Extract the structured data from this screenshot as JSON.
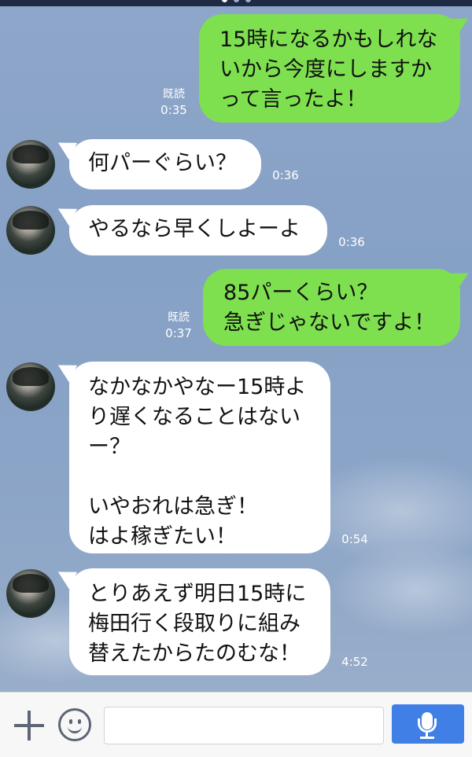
{
  "page_indicator": {
    "count": 3,
    "active_index": 0
  },
  "messages": [
    {
      "direction": "out",
      "text": "15時になるかもしれな\nいから今度にしますか\nって言ったよ！",
      "read": "既読",
      "time": "0:35"
    },
    {
      "direction": "in",
      "text": "何パーぐらい？",
      "time": "0:36"
    },
    {
      "direction": "in",
      "text": "やるなら早くしよーよ",
      "time": "0:36"
    },
    {
      "direction": "out",
      "text": "85パーくらい？\n急ぎじゃないですよ！",
      "read": "既読",
      "time": "0:37"
    },
    {
      "direction": "in",
      "text": "なかなかやなー15時よ\nり遅くなることはない\nー？\n\nいやおれは急ぎ！\nはよ稼ぎたい！",
      "time": "0:54"
    },
    {
      "direction": "in",
      "text": "とりあえず明日15時に\n梅田行く段取りに組み\n替えたからたのむな！",
      "time": "4:52"
    }
  ],
  "input_bar": {
    "plus_icon": "plus-icon",
    "emoji_icon": "smiley-icon",
    "text_value": "",
    "mic_icon": "microphone-icon"
  },
  "colors": {
    "outgoing_bubble": "#7ee04f",
    "incoming_bubble": "#ffffff",
    "mic_button": "#3f7fe6"
  }
}
